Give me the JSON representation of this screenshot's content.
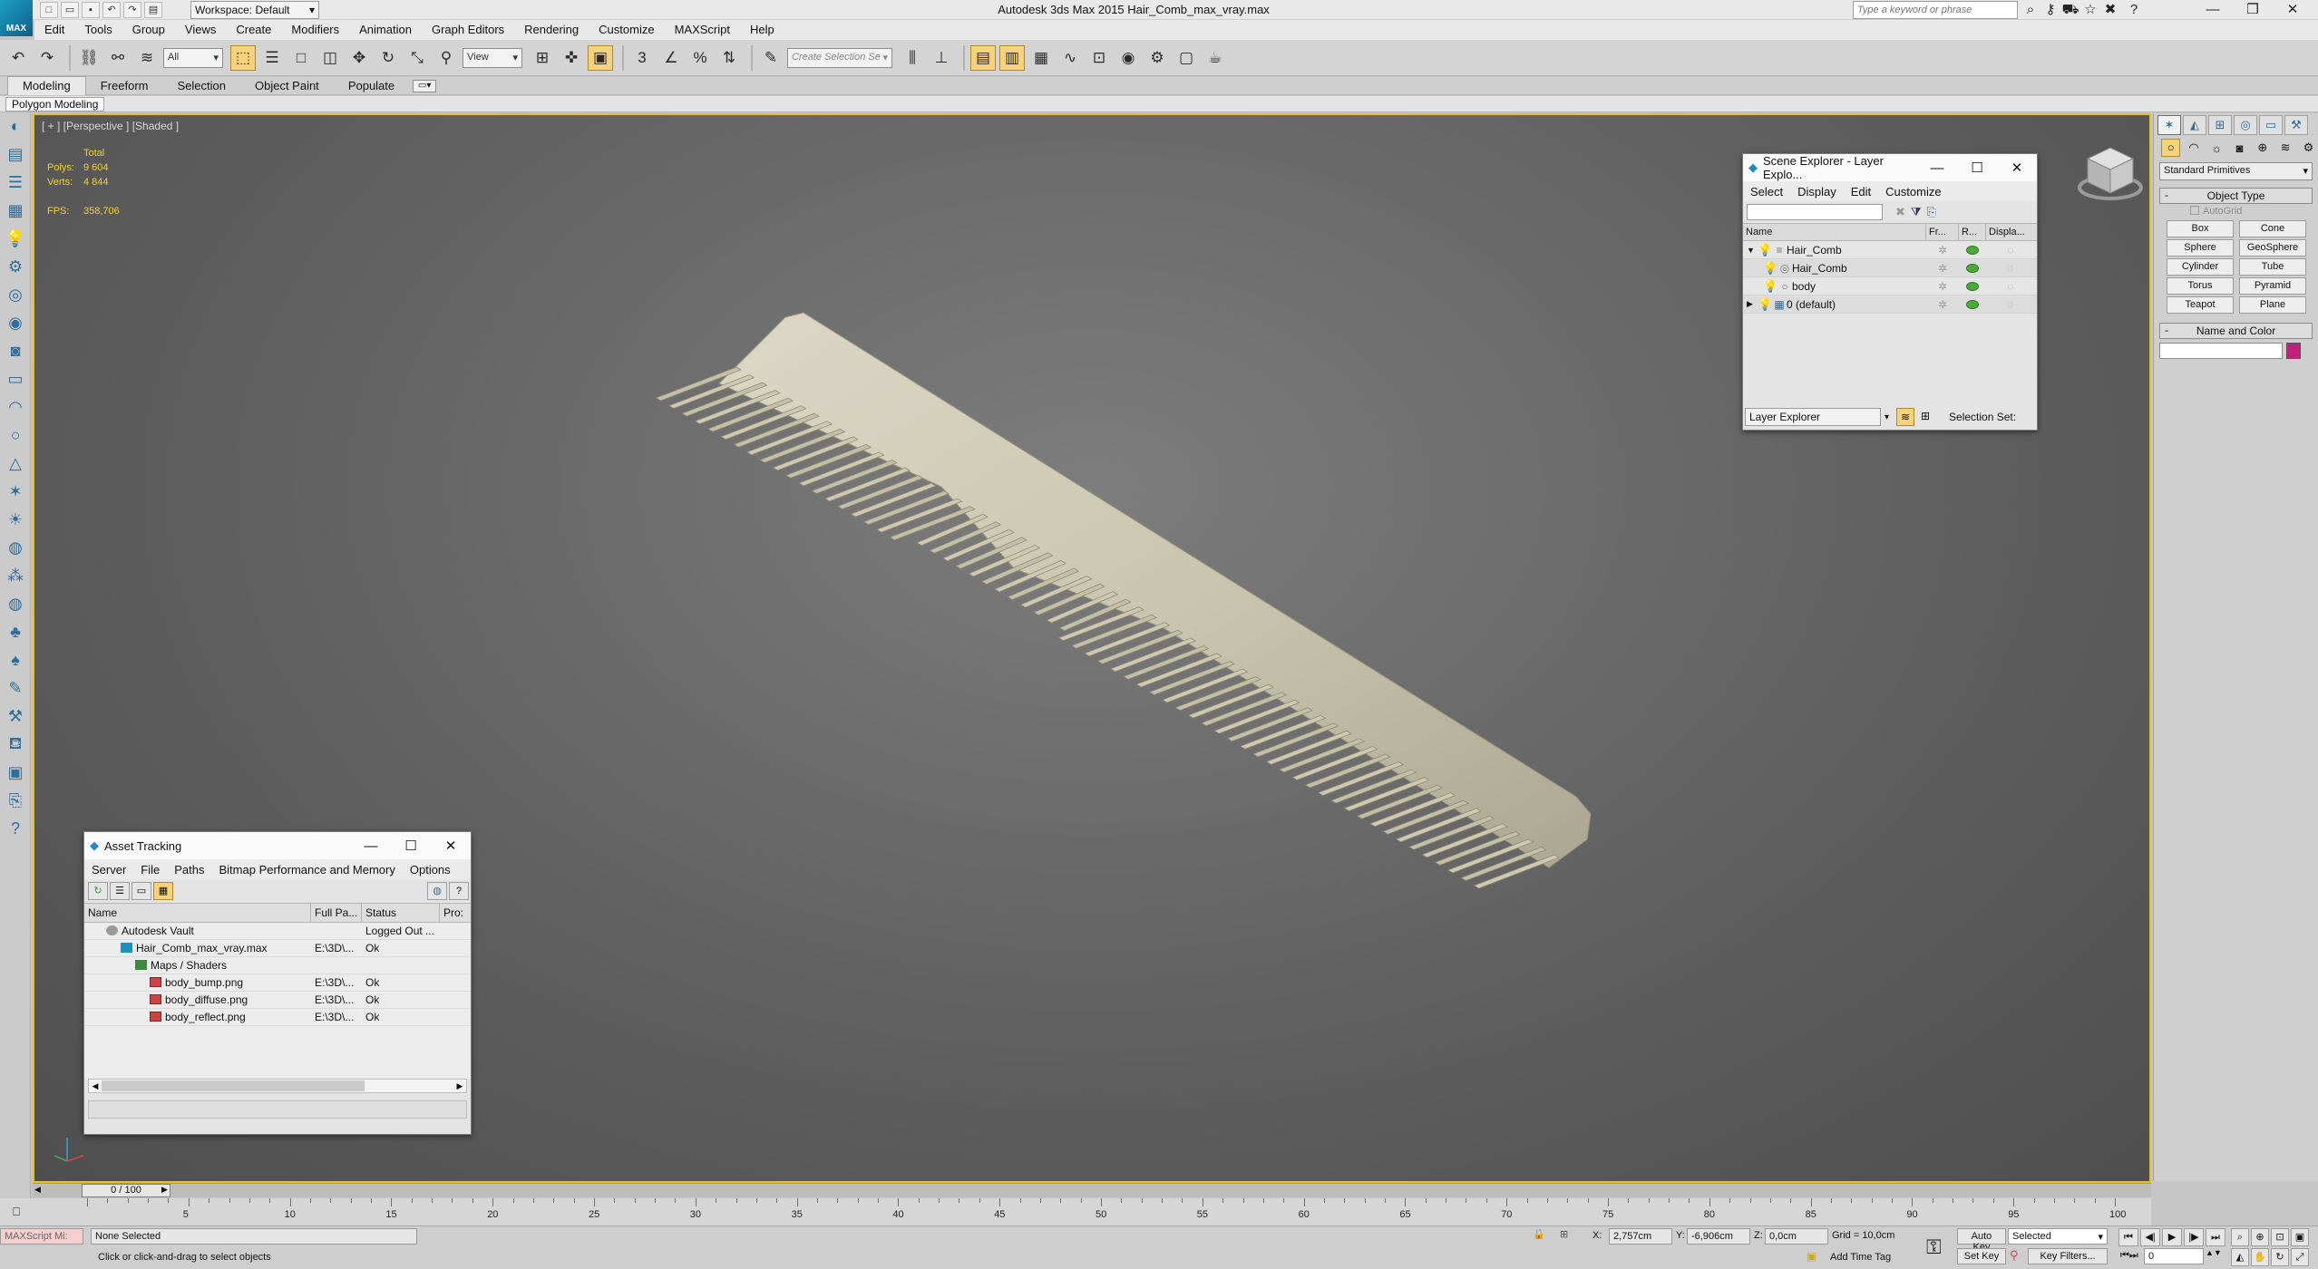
{
  "app": {
    "workspace": "Workspace: Default",
    "window_title": "Autodesk 3ds Max  2015    Hair_Comb_max_vray.max",
    "search_placeholder": "Type a keyword or phrase",
    "logo_text": "MAX"
  },
  "menu": [
    "Edit",
    "Tools",
    "Group",
    "Views",
    "Create",
    "Modifiers",
    "Animation",
    "Graph Editors",
    "Rendering",
    "Customize",
    "MAXScript",
    "Help"
  ],
  "toolbar": {
    "selection_filter": "All",
    "reference_coord": "View",
    "named_selection": "Create Selection Se"
  },
  "ribbon": {
    "tabs": [
      "Modeling",
      "Freeform",
      "Selection",
      "Object Paint",
      "Populate"
    ],
    "selected_tab": "Modeling",
    "sub_label": "Polygon Modeling"
  },
  "viewport": {
    "label": "[ + ] [Perspective ] [Shaded ]",
    "stats": {
      "total_label": "Total",
      "polys_label": "Polys:",
      "polys": "9 604",
      "verts_label": "Verts:",
      "verts": "4 844",
      "fps_label": "FPS:",
      "fps": "358,706"
    },
    "accent": "#e7c21e"
  },
  "scene_explorer": {
    "title": "Scene Explorer - Layer Explo...",
    "menu": [
      "Select",
      "Display",
      "Edit",
      "Customize"
    ],
    "columns": [
      "Name",
      "Fr...",
      "R...",
      "Displa..."
    ],
    "rows": [
      {
        "name": "Hair_Comb",
        "indent": 0,
        "expander": "▼"
      },
      {
        "name": "Hair_Comb",
        "indent": 1,
        "expander": ""
      },
      {
        "name": "body",
        "indent": 1,
        "expander": ""
      },
      {
        "name": "0 (default)",
        "indent": 0,
        "expander": "▶"
      }
    ],
    "mode": "Layer Explorer",
    "selection_set_label": "Selection Set:"
  },
  "asset_tracking": {
    "title": "Asset Tracking",
    "menu": [
      "Server",
      "File",
      "Paths",
      "Bitmap Performance and Memory",
      "Options"
    ],
    "columns": [
      "Name",
      "Full Pa...",
      "Status",
      "Pro:"
    ],
    "rows": [
      {
        "name": "Autodesk Vault",
        "path": "",
        "status": "Logged Out ...",
        "indent": 1,
        "icon": "vault-icon"
      },
      {
        "name": "Hair_Comb_max_vray.max",
        "path": "E:\\3D\\...",
        "status": "Ok",
        "indent": 2,
        "icon": "max-file-icon"
      },
      {
        "name": "Maps / Shaders",
        "path": "",
        "status": "",
        "indent": 3,
        "icon": "folder-icon"
      },
      {
        "name": "body_bump.png",
        "path": "E:\\3D\\...",
        "status": "Ok",
        "indent": 4,
        "icon": "image-icon"
      },
      {
        "name": "body_diffuse.png",
        "path": "E:\\3D\\...",
        "status": "Ok",
        "indent": 4,
        "icon": "image-icon"
      },
      {
        "name": "body_reflect.png",
        "path": "E:\\3D\\...",
        "status": "Ok",
        "indent": 4,
        "icon": "image-icon"
      }
    ]
  },
  "command_panel": {
    "category": "Standard Primitives",
    "object_type_label": "Object Type",
    "autogrid_label": "AutoGrid",
    "buttons": [
      "Box",
      "Cone",
      "Sphere",
      "GeoSphere",
      "Cylinder",
      "Tube",
      "Torus",
      "Pyramid",
      "Teapot",
      "Plane"
    ],
    "name_color_label": "Name and Color",
    "swatch_color": "#c2207a"
  },
  "timeline": {
    "slider_label": "0 / 100",
    "ticks": [
      "5",
      "10",
      "15",
      "20",
      "25",
      "30",
      "35",
      "40",
      "45",
      "50",
      "55",
      "60",
      "65",
      "70",
      "75",
      "80",
      "85",
      "90",
      "95",
      "100"
    ]
  },
  "status": {
    "maxscript": "MAXScript Mi:",
    "selected": "None Selected",
    "prompt": "Click or click-and-drag to select objects",
    "x_label": "X:",
    "x": "2,757cm",
    "y_label": "Y:",
    "y": "-6,906cm",
    "z_label": "Z:",
    "z": "0,0cm",
    "grid": "Grid = 10,0cm",
    "add_time_tag": "Add Time Tag",
    "auto_key": "Auto Key",
    "set_key": "Set Key",
    "key_mode": "Selected",
    "key_filters": "Key Filters...",
    "frame": "0"
  }
}
